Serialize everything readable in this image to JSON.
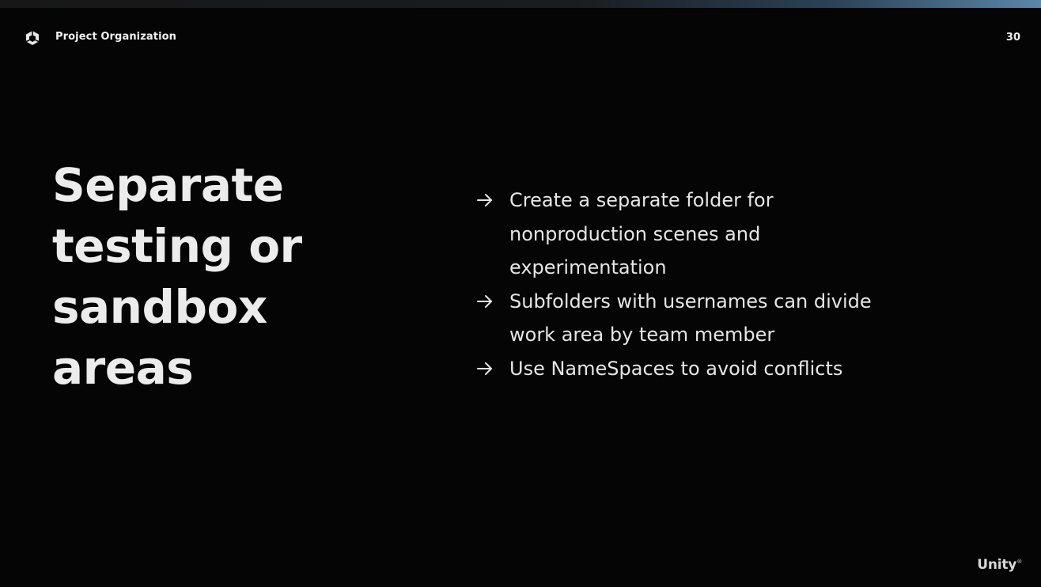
{
  "header": {
    "title": "Project Organization",
    "page_number": "30",
    "logo_icon": "unity-cube-icon"
  },
  "headline": {
    "text": "Separate testing or sandbox areas"
  },
  "bullets": [
    {
      "icon": "arrow-right-icon",
      "text": "Create a separate folder for nonproduction scenes and experimentation"
    },
    {
      "icon": "arrow-right-icon",
      "text": "Subfolders with usernames can divide work area by team member"
    },
    {
      "icon": "arrow-right-icon",
      "text": "Use NameSpaces to avoid conflicts"
    }
  ],
  "footer": {
    "brand": "Unity",
    "brand_mark": "®"
  },
  "colors": {
    "background": "#050505",
    "text": "#eaeaea",
    "accent_strip": "#5b87a8"
  }
}
